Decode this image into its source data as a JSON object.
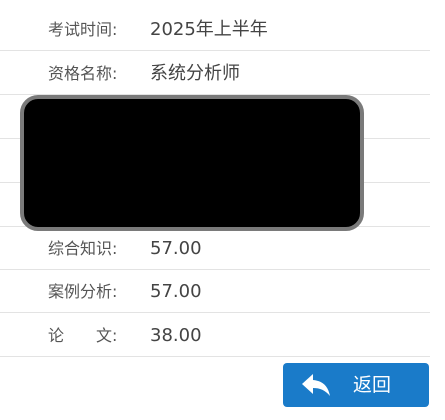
{
  "score_rows": [
    {
      "label": "考试时间:",
      "value": "2025年上半年"
    },
    {
      "label": "资格名称:",
      "value": "系统分析师"
    },
    {
      "label": "",
      "value": ""
    },
    {
      "label": "",
      "value": ""
    },
    {
      "label": "",
      "value": ""
    },
    {
      "label": "综合知识:",
      "value": "57.00"
    },
    {
      "label": "案例分析:",
      "value": "57.00"
    },
    {
      "label": "论　　文:",
      "value": "38.00"
    }
  ],
  "redaction": {
    "color": "#000000",
    "border_color": "#7a7a7a"
  },
  "back_button": {
    "label": "返回",
    "icon": "reply-arrow-icon",
    "color": "#1a7bc9"
  }
}
